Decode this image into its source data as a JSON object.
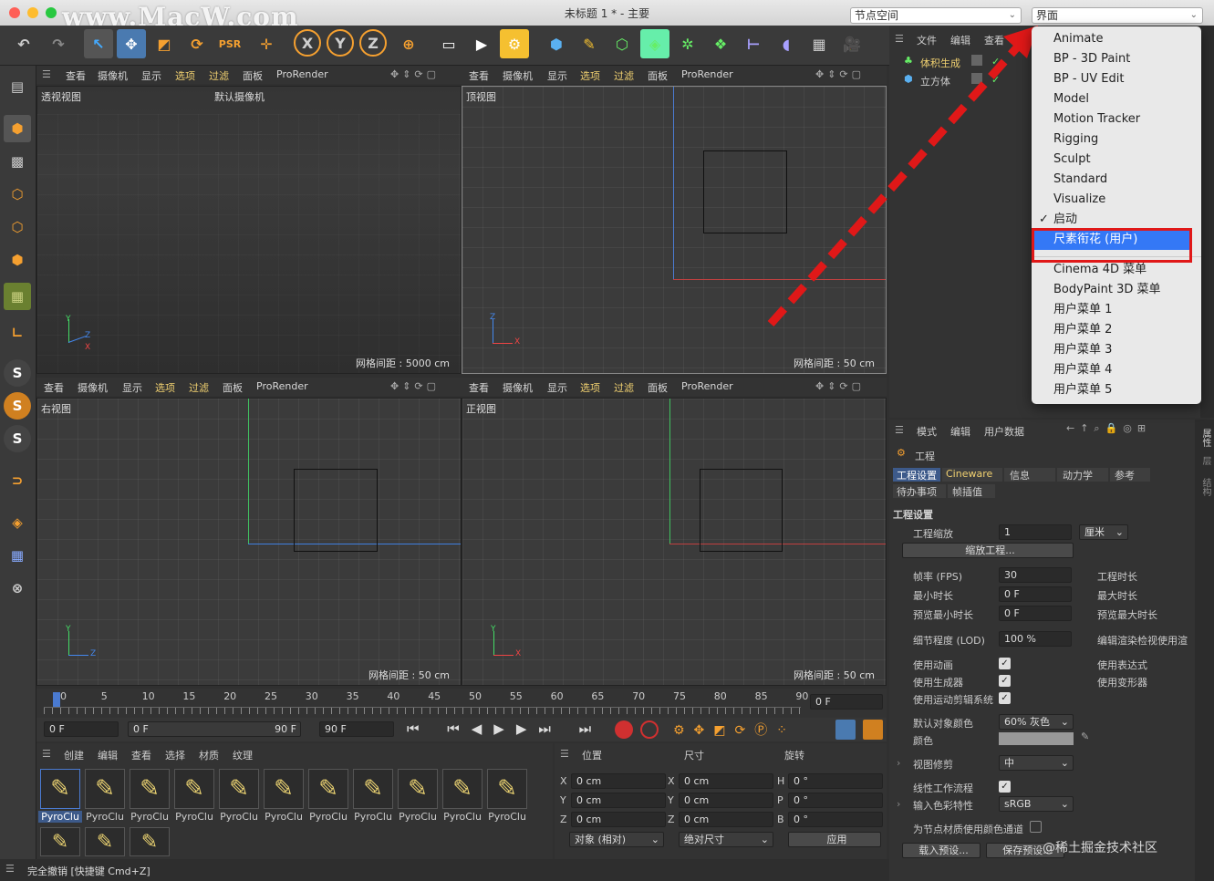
{
  "window": {
    "watermark": "www.MacW.com",
    "title": "未标题 1 * - 主要",
    "node_space_label": "节点空间",
    "layout_label": "界面"
  },
  "viewport_menu": [
    "查看",
    "摄像机",
    "显示",
    "选项",
    "过滤",
    "面板",
    "ProRender"
  ],
  "viewports": {
    "persp": {
      "name": "透视视图",
      "camera": "默认摄像机",
      "grid": "网格间距 : 5000 cm"
    },
    "top": {
      "name": "顶视图",
      "grid": "网格间距 : 50 cm"
    },
    "right": {
      "name": "右视图",
      "grid": "网格间距 : 50 cm"
    },
    "front": {
      "name": "正视图",
      "grid": "网格间距 : 50 cm"
    }
  },
  "axes": {
    "x": "X",
    "y": "Y",
    "z": "Z"
  },
  "timeline": {
    "ticks": [
      "0",
      "5",
      "10",
      "15",
      "20",
      "25",
      "30",
      "35",
      "40",
      "45",
      "50",
      "55",
      "60",
      "65",
      "70",
      "75",
      "80",
      "85",
      "90"
    ],
    "current": "0 F",
    "start": "0 F",
    "range_start": "0 F",
    "range_end": "90 F",
    "end": "90 F"
  },
  "toolbar_axes": [
    "X",
    "Y",
    "Z"
  ],
  "material_panel": {
    "menu": [
      "创建",
      "编辑",
      "查看",
      "选择",
      "材质",
      "纹理"
    ],
    "items": [
      "PyroClu",
      "PyroClu",
      "PyroClu",
      "PyroClu",
      "PyroClu",
      "PyroClu",
      "PyroClu",
      "PyroClu",
      "PyroClu",
      "PyroClu",
      "PyroClu"
    ]
  },
  "coords": {
    "headers": [
      "位置",
      "尺寸",
      "旋转"
    ],
    "rows": [
      {
        "a": "X",
        "pos": "0 cm",
        "b": "X",
        "size": "0 cm",
        "c": "H",
        "rot": "0 °"
      },
      {
        "a": "Y",
        "pos": "0 cm",
        "b": "Y",
        "size": "0 cm",
        "c": "P",
        "rot": "0 °"
      },
      {
        "a": "Z",
        "pos": "0 cm",
        "b": "Z",
        "size": "0 cm",
        "c": "B",
        "rot": "0 °"
      }
    ],
    "mode": "对象 (相对)",
    "size_mode": "绝对尺寸",
    "apply": "应用"
  },
  "object_manager": {
    "menu": [
      "文件",
      "编辑",
      "查看"
    ],
    "items": [
      "体积生成",
      "立方体"
    ]
  },
  "attributes": {
    "menu": [
      "模式",
      "编辑",
      "用户数据"
    ],
    "title": "工程",
    "tabs": [
      "工程设置",
      "Cineware",
      "信息",
      "动力学",
      "参考"
    ],
    "tabs2": [
      "待办事项",
      "帧插值"
    ],
    "section": "工程设置",
    "scale_label": "工程缩放",
    "scale_value": "1",
    "scale_unit": "厘米",
    "scale_button": "缩放工程...",
    "fps_label": "帧率 (FPS)",
    "fps_value": "30",
    "min_label": "最小时长",
    "min_value": "0 F",
    "pmin_label": "预览最小时长",
    "pmin_value": "0 F",
    "proj_len": "工程时长",
    "max_len": "最大时长",
    "pmax_len": "预览最大时长",
    "lod_label": "细节程度 (LOD)",
    "lod_value": "100 %",
    "lod_right": "编辑渲染检视使用渲",
    "anim": "使用动画",
    "gen": "使用生成器",
    "mograph": "使用运动剪辑系统",
    "expr": "使用表达式",
    "deform": "使用变形器",
    "objcolor_label": "默认对象颜色",
    "objcolor_value": "60% 灰色",
    "color_label": "颜色",
    "clip_label": "视图修剪",
    "clip_value": "中",
    "linear": "线性工作流程",
    "profile_label": "输入色彩特性",
    "profile_value": "sRGB",
    "nodecolor": "为节点材质使用颜色通道",
    "load_preset": "载入预设...",
    "save_preset": "保存预设...",
    "credit": "@稀土掘金技术社区"
  },
  "side_tabs": [
    "属性",
    "层",
    "结构"
  ],
  "layout_dropdown": {
    "items": [
      "Animate",
      "BP - 3D Paint",
      "BP - UV Edit",
      "Model",
      "Motion Tracker",
      "Rigging",
      "Sculpt",
      "Standard",
      "Visualize",
      "启动",
      "尺素衔花 (用户)",
      "Cinema 4D 菜单",
      "BodyPaint 3D 菜单",
      "用户菜单 1",
      "用户菜单 2",
      "用户菜单 3",
      "用户菜单 4",
      "用户菜单 5"
    ],
    "checked": "启动",
    "highlighted": "尺素衔花 (用户)"
  },
  "status": "完全撤销 [快捷键 Cmd+Z]",
  "colors": {
    "accent": "#3478f6",
    "annotation": "#e01818",
    "x_axis": "#e04040",
    "y_axis": "#40d060",
    "z_axis": "#4080e0"
  }
}
